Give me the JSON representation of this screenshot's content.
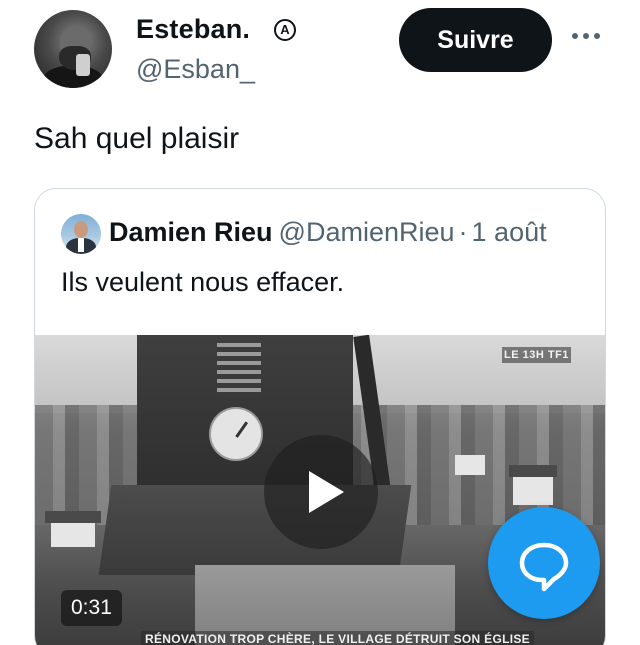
{
  "author": {
    "display_name": "Esteban.",
    "badge_icon": "circled-a-icon",
    "badge_glyph": "A",
    "handle": "@Esban_"
  },
  "actions": {
    "follow_label": "Suivre",
    "more_icon": "more-horizontal-icon"
  },
  "tweet": {
    "text": "Sah quel plaisir"
  },
  "quoted": {
    "display_name": "Damien Rieu",
    "handle": "@DamienRieu",
    "separator": "·",
    "date": "1 août",
    "text": "Ils veulent nous effacer.",
    "video": {
      "duration": "0:31",
      "channel_logo": "LE 13H TF1",
      "caption": "RÉNOVATION TROP CHÈRE, LE VILLAGE DÉTRUIT SON ÉGLISE",
      "play_icon": "play-icon"
    }
  },
  "fab": {
    "icon": "reply-bubble-icon",
    "color": "#1d9bf0"
  },
  "colors": {
    "text": "#0f1419",
    "secondary": "#536471",
    "border": "#cfd9de",
    "accent": "#1d9bf0"
  }
}
